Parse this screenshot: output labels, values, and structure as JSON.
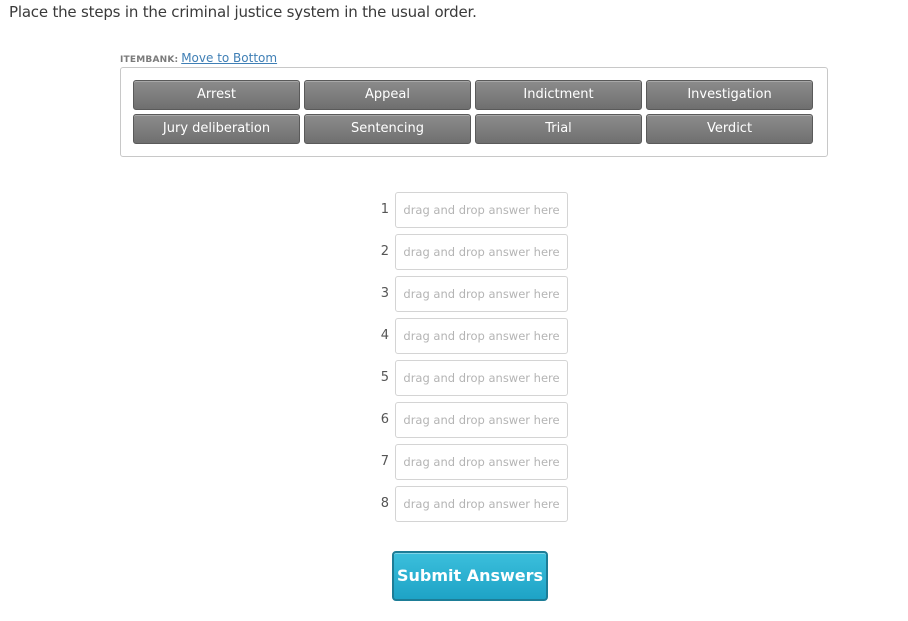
{
  "question": "Place the steps in the criminal justice system in the usual order.",
  "itembank": {
    "label": "ITEMBANK:",
    "move_link": "Move to Bottom",
    "items": [
      "Arrest",
      "Appeal",
      "Indictment",
      "Investigation",
      "Jury deliberation",
      "Sentencing",
      "Trial",
      "Verdict"
    ]
  },
  "slots": [
    {
      "number": "1",
      "placeholder": "drag and drop answer here"
    },
    {
      "number": "2",
      "placeholder": "drag and drop answer here"
    },
    {
      "number": "3",
      "placeholder": "drag and drop answer here"
    },
    {
      "number": "4",
      "placeholder": "drag and drop answer here"
    },
    {
      "number": "5",
      "placeholder": "drag and drop answer here"
    },
    {
      "number": "6",
      "placeholder": "drag and drop answer here"
    },
    {
      "number": "7",
      "placeholder": "drag and drop answer here"
    },
    {
      "number": "8",
      "placeholder": "drag and drop answer here"
    }
  ],
  "submit_label": "Submit Answers",
  "colors": {
    "item_bg": "#7d7d7d",
    "submit_bg": "#2bb1d3",
    "link": "#3f7fb5"
  }
}
